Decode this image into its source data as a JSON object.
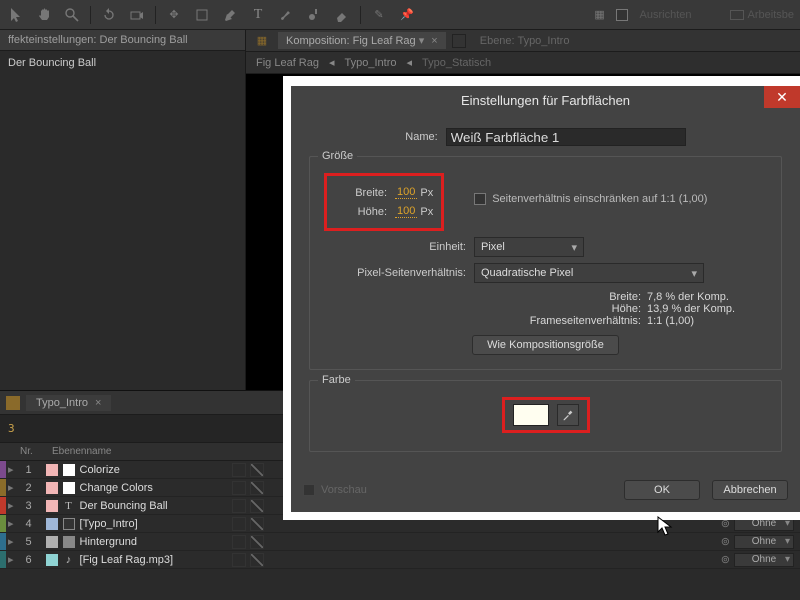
{
  "toolbar": {
    "align_label": "Ausrichten",
    "workspace_label": "Arbeitsbe"
  },
  "panels": {
    "effects_tab": "ffekteinstellungen: Der Bouncing Ball",
    "effects_item": "Der Bouncing Ball"
  },
  "comp_tabs": {
    "comp_tab": "Komposition: Fig Leaf Rag",
    "layer_tab": "Ebene: Typo_Intro"
  },
  "flowchart": [
    "Fig Leaf Rag",
    "Typo_Intro",
    "Typo_Statisch"
  ],
  "timeline": {
    "tab": "Typo_Intro",
    "time": "3",
    "header": {
      "idx": "Nr.",
      "name": "Ebenenname"
    },
    "rows": [
      {
        "n": "1",
        "name": "Colorize",
        "color": "#7c4a8d",
        "accent": "#f2b6b6",
        "icon": "adjustment"
      },
      {
        "n": "2",
        "name": "Change Colors",
        "color": "#8a6c2a",
        "accent": "#f2b6b6",
        "icon": "adjustment"
      },
      {
        "n": "3",
        "name": "Der Bouncing Ball",
        "color": "#c0392b",
        "accent": "#f2b6b6",
        "icon": "text"
      },
      {
        "n": "4",
        "name": "[Typo_Intro]",
        "color": "#6b8f3e",
        "accent": "#9fb7d8",
        "icon": "comp"
      },
      {
        "n": "5",
        "name": "Hintergrund",
        "color": "#2e6f8e",
        "accent": "#b0b0b0",
        "icon": "solid"
      },
      {
        "n": "6",
        "name": "[Fig Leaf Rag.mp3]",
        "color": "#2c6e6e",
        "accent": "#8fd3d3",
        "icon": "audio"
      }
    ],
    "mode": "Ohne",
    "right_icon": "⊚"
  },
  "dialog": {
    "title": "Einstellungen für Farbflächen",
    "close": "✕",
    "name_label": "Name:",
    "name_value": "Weiß Farbfläche 1",
    "size": {
      "group": "Größe",
      "width_label": "Breite:",
      "width_value": "100",
      "height_label": "Höhe:",
      "height_value": "100",
      "px": "Px",
      "units_label": "Einheit:",
      "units_value": "Pixel",
      "par_label": "Pixel-Seitenverhältnis:",
      "par_value": "Quadratische Pixel",
      "lock_label": "Seitenverhältnis einschränken auf 1:1 (1,00)",
      "info_w_label": "Breite:",
      "info_w_value": "7,8 % der Komp.",
      "info_h_label": "Höhe:",
      "info_h_value": "13,9 % der Komp.",
      "info_far_label": "Frameseitenverhältnis:",
      "info_far_value": "1:1 (1,00)",
      "make_comp_size": "Wie Kompositionsgröße"
    },
    "color": {
      "group": "Farbe"
    },
    "preview_label": "Vorschau",
    "ok": "OK",
    "cancel": "Abbrechen"
  }
}
